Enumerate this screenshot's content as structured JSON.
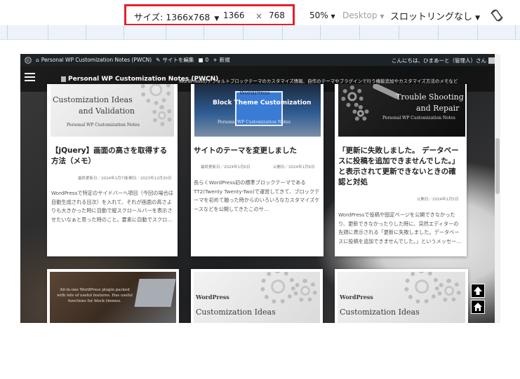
{
  "devtools": {
    "size_label": "サイズ: 1366x768",
    "width": "1366",
    "times": "×",
    "height": "768",
    "zoom": "50%",
    "device": "Desktop",
    "throttle": "スロットリングなし",
    "dropdown_glyph": "▼",
    "rotate_icon": "rotate-icon"
  },
  "adminbar": {
    "site_name": "Personal WP Customization Notes (PWCN)",
    "edit_site": "サイトを編集",
    "comments_count": "0",
    "new": "新規",
    "greeting": "こんにちは、ひまあーと（管理人）さん"
  },
  "header": {
    "site_title": "Personal WP Customization Notes (PWCN)",
    "tagline": "WordPressのデフォルトブロックテーマのカスタマイズ情報、自作のテーマやプラグインで行う機能追加やカスタマイズ方法のメモなど"
  },
  "cards": [
    {
      "thumb_title_1": "Customization Ideas",
      "thumb_title_2": "and Validation",
      "thumb_sub": "Personal WP Customization Notes",
      "title": "【jQuery】画面の高さを取得する方法（メモ）",
      "meta_updated": "最終更新日／2024年1月7日",
      "meta_published": "公開日／2023年12月30日",
      "excerpt": "WordPressで特定のサイドバーへ項目（今回の場合は自動生成される目次）を入れて、それが画面の高さよりも大きかった時に自動で縦スクロールバーを表示させたいなぁと思った時のこと。要素に自動でスクロ…"
    },
    {
      "thumb_title_1": "WordPress",
      "thumb_title_2": "Block Theme Customization",
      "thumb_sub": "Personal WP Customization Notes",
      "title": "サイトのテーマを変更しました",
      "meta_updated": "最終更新日／2024年1月6日",
      "meta_published": "公開日／2024年1月6日",
      "excerpt": "長らくWordPress初の標準ブロックテーマであるTT2(Twenty Twenty-Two)で運営してきて、ブロックテーマを初めて触った時からのいろいろなカスタマイズケースなどを公開してきたこのサ…"
    },
    {
      "thumb_title_1": "Trouble Shooting",
      "thumb_title_2": "and Repair",
      "thumb_sub": "Personal WP Customization Notes",
      "title": "「更新に失敗しました。 データベースに投稿を追加できませんでした。」と表示されて更新できないときの確認と対処",
      "meta_published": "公開日／2024年1月5日",
      "excerpt": "WordPressで投稿や固定ページを公開できなかったり、更新できなかったりした時に、突然エディターの先頭に表示される「更新に失敗しました。データベースに投稿を追加できませんでした。」というメッセー…"
    },
    {
      "thumb_text": "All-in-one WordPress plugin packed with lots of useful features. Has useful functions for block themes."
    },
    {
      "thumb_title_1": "WordPress",
      "thumb_title_2": "Customization Ideas"
    },
    {
      "thumb_title_1": "WordPress",
      "thumb_title_2": "Customization Ideas"
    }
  ],
  "page_buttons": {
    "top_icon": "arrow-up-icon",
    "home_icon": "home-icon"
  }
}
